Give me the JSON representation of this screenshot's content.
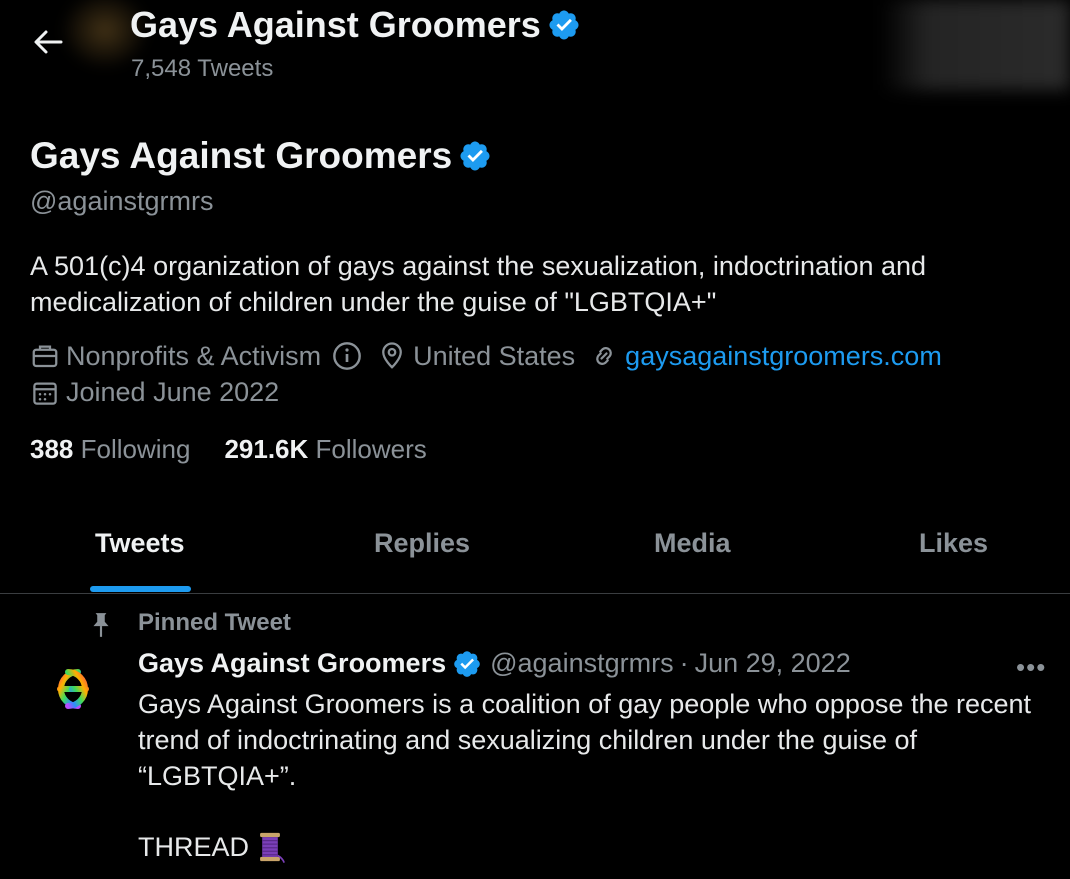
{
  "header": {
    "title": "Gays Against Groomers",
    "tweet_count": "7,548 Tweets"
  },
  "profile": {
    "name": "Gays Against Groomers",
    "handle": "@againstgrmrs",
    "bio": "A 501(c)4 organization of gays against the sexualization, indoctrination and medicalization of children under the guise of \"LGBTQIA+\"",
    "category": "Nonprofits & Activism",
    "location": "United States",
    "website": "gaysagainstgroomers.com",
    "joined": "Joined June 2022",
    "following_count": "388",
    "following_label": "Following",
    "followers_count": "291.6K",
    "followers_label": "Followers"
  },
  "tabs": [
    {
      "label": "Tweets",
      "active": true
    },
    {
      "label": "Replies",
      "active": false
    },
    {
      "label": "Media",
      "active": false
    },
    {
      "label": "Likes",
      "active": false
    }
  ],
  "pinned_tweet": {
    "label": "Pinned Tweet",
    "author_name": "Gays Against Groomers",
    "author_handle": "@againstgrmrs",
    "separator": "·",
    "date": "Jun 29, 2022",
    "more": "•••",
    "text": "Gays Against Groomers is a coalition of gay people who oppose the recent trend of indoctrinating and sexualizing children under the guise of “LGBTQIA+”.",
    "thread_label": "THREAD"
  },
  "colors": {
    "background": "#000000",
    "accent": "#1d9bf0",
    "secondary_text": "#8b9298",
    "primary_text": "#e7e9ea"
  },
  "icons": [
    "back-arrow-icon",
    "verified-badge-icon",
    "briefcase-icon",
    "info-icon",
    "location-pin-icon",
    "link-icon",
    "calendar-icon",
    "pin-icon",
    "more-icon",
    "spool-icon"
  ]
}
